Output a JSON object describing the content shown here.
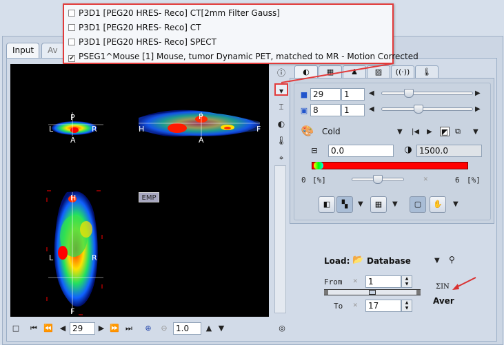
{
  "tabs": {
    "input": "Input",
    "aver": "Av"
  },
  "popup": {
    "items": [
      {
        "label": "P3D1 [PEG20 HRES- Reco] CT[2mm Filter Gauss]",
        "checked": false
      },
      {
        "label": "P3D1 [PEG20 HRES- Reco] CT",
        "checked": false
      },
      {
        "label": "P3D1 [PEG20 HRES- Reco] SPECT",
        "checked": false
      },
      {
        "label": "PSEG1^Mouse [1] Mouse, tumor Dynamic PET, matched to MR - Motion Corrected",
        "checked": true
      }
    ]
  },
  "viewer": {
    "axial": {
      "top": "P",
      "left": "L",
      "right": "R",
      "bottom": "A"
    },
    "sagittal": {
      "top": "P",
      "left": "H",
      "right": "F",
      "bottom": "A"
    },
    "coronal": {
      "top": "H",
      "left": "L",
      "right": "R",
      "bottom": "F"
    },
    "emp_label": "EMP"
  },
  "controls": {
    "slice_value": "29",
    "slice_step": "1",
    "frame_value": "8",
    "frame_step": "1",
    "colormap": "Cold",
    "min_value": "0.0",
    "max_value": "1500.0",
    "pct_min": "0",
    "pct_unit": "[%]",
    "pct_max": "6",
    "pct_unit2": "[%]"
  },
  "load": {
    "label": "Load:",
    "source": "Database",
    "from_label": "From",
    "from_value": "1",
    "to_label": "To",
    "to_value": "17",
    "sum_label": "ΣIN",
    "aver_label": "Aver"
  },
  "bottom": {
    "slice_value": "29",
    "zoom_value": "1.0"
  },
  "colors": {
    "accent_red": "#e23b3b",
    "colorbar": "#ff0000"
  }
}
